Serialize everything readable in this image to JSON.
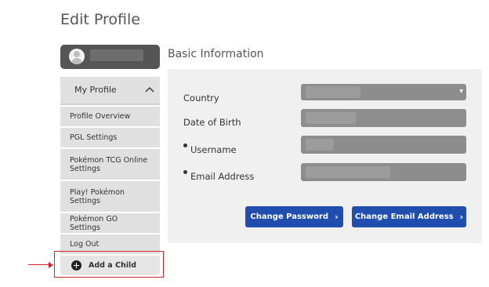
{
  "page": {
    "title": "Edit Profile"
  },
  "sidebar": {
    "header_label": "My Profile",
    "items": [
      {
        "label": "Profile Overview"
      },
      {
        "label": "PGL Settings"
      },
      {
        "label": "Pokémon TCG Online Settings"
      },
      {
        "label": "Play! Pokémon Settings"
      },
      {
        "label": "Pokémon GO Settings"
      },
      {
        "label": "Log Out"
      }
    ],
    "add_child_label": "Add a Child"
  },
  "main": {
    "section_title": "Basic Information",
    "fields": [
      {
        "label": "Country",
        "required": false
      },
      {
        "label": "Date of Birth",
        "required": false
      },
      {
        "label": "Username",
        "required": true
      },
      {
        "label": "Email Address",
        "required": true
      }
    ],
    "buttons": {
      "change_password": "Change Password",
      "change_email": "Change Email Address"
    }
  },
  "colors": {
    "primary_button": "#1f4eae",
    "highlight": "#d0242b",
    "sidebar_bg": "#e0e0e0",
    "panel_bg": "#f0f0f0",
    "field_bg": "#8d8d8d"
  },
  "icons": [
    "user-avatar-icon",
    "chevron-up-icon",
    "plus-circle-icon",
    "chevron-right-icon",
    "dropdown-caret-icon"
  ]
}
